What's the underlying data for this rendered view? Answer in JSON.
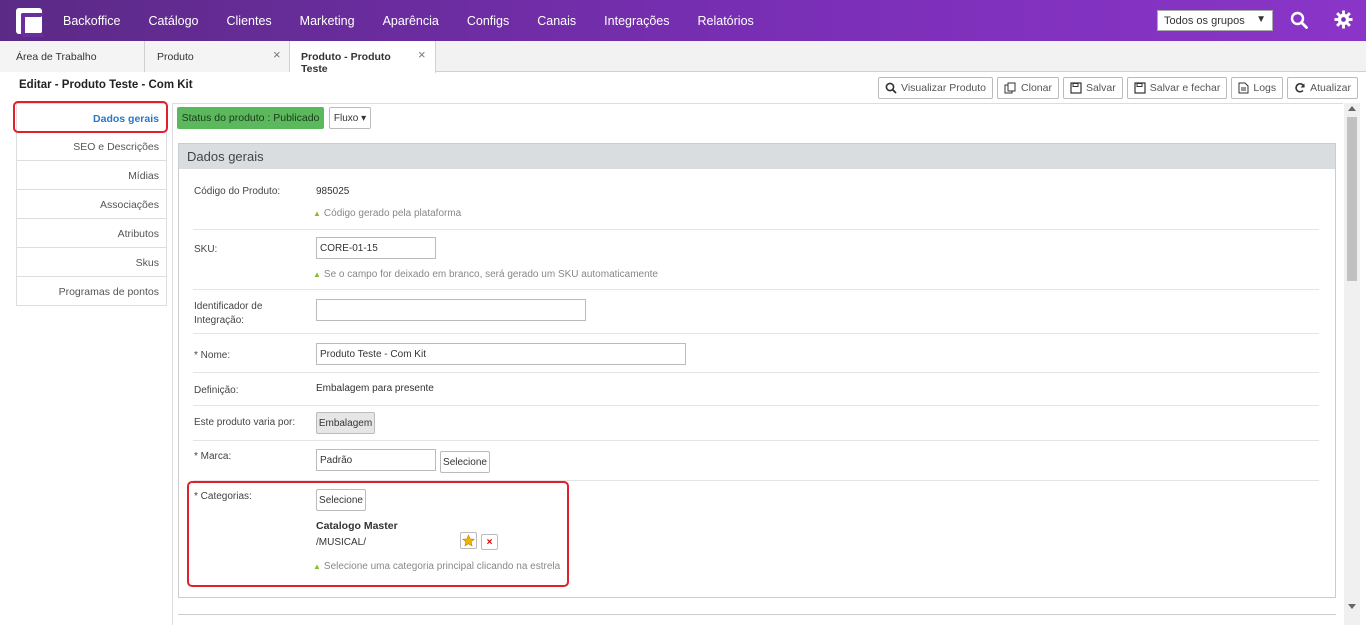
{
  "nav": {
    "items": [
      "Backoffice",
      "Catálogo",
      "Clientes",
      "Marketing",
      "Aparência",
      "Configs",
      "Canais",
      "Integrações",
      "Relatórios"
    ],
    "group_select": "Todos os grupos",
    "caret": "▼"
  },
  "tabs": [
    {
      "label": "Área de Trabalho"
    },
    {
      "label": "Produto",
      "close": "×"
    },
    {
      "label": "Produto - Produto Teste",
      "close": "×"
    }
  ],
  "page": {
    "title": "Editar - Produto Teste - Com Kit"
  },
  "toolbar": {
    "view": "Visualizar Produto",
    "clone": "Clonar",
    "save": "Salvar",
    "save_close": "Salvar e fechar",
    "logs": "Logs",
    "refresh": "Atualizar"
  },
  "sidebar": {
    "items": [
      "Dados gerais",
      "SEO e Descrições",
      "Mídias",
      "Associações",
      "Atributos",
      "Skus",
      "Programas de pontos"
    ]
  },
  "status": {
    "label": "Status do produto : Publicado",
    "fluxo": "Fluxo ▾"
  },
  "panel": {
    "title": "Dados gerais"
  },
  "form": {
    "codigo_label": "Código do Produto:",
    "codigo_value": "985025",
    "codigo_hint": "Código gerado pela plataforma",
    "sku_label": "SKU:",
    "sku_value": "CORE-01-15",
    "sku_hint": "Se o campo for deixado em branco, será gerado um SKU automaticamente",
    "ident_label_1": "Identificador de",
    "ident_label_2": "Integração:",
    "ident_value": "",
    "nome_label": "* Nome:",
    "nome_value": "Produto Teste - Com Kit",
    "definicao_label": "Definição:",
    "definicao_value": "Embalagem para presente",
    "varia_label": "Este produto varia por:",
    "varia_value": "Embalagem",
    "marca_label": "* Marca:",
    "marca_value": "Padrão",
    "marca_button": "Selecione",
    "categorias_label": "* Categorias:",
    "categorias_button": "Selecione",
    "catalog_name": "Catalogo Master",
    "catalog_path": "/MUSICAL/",
    "delete_glyph": "×",
    "categorias_hint": "Selecione uma categoria principal clicando na estrela",
    "hint_marker": "▲"
  },
  "colors": {
    "nav_start": "#5b2a86",
    "nav_end": "#8a35c8",
    "status_green": "#5cb85c",
    "highlight_red": "#e0202a",
    "active_blue": "#2a78c5"
  }
}
